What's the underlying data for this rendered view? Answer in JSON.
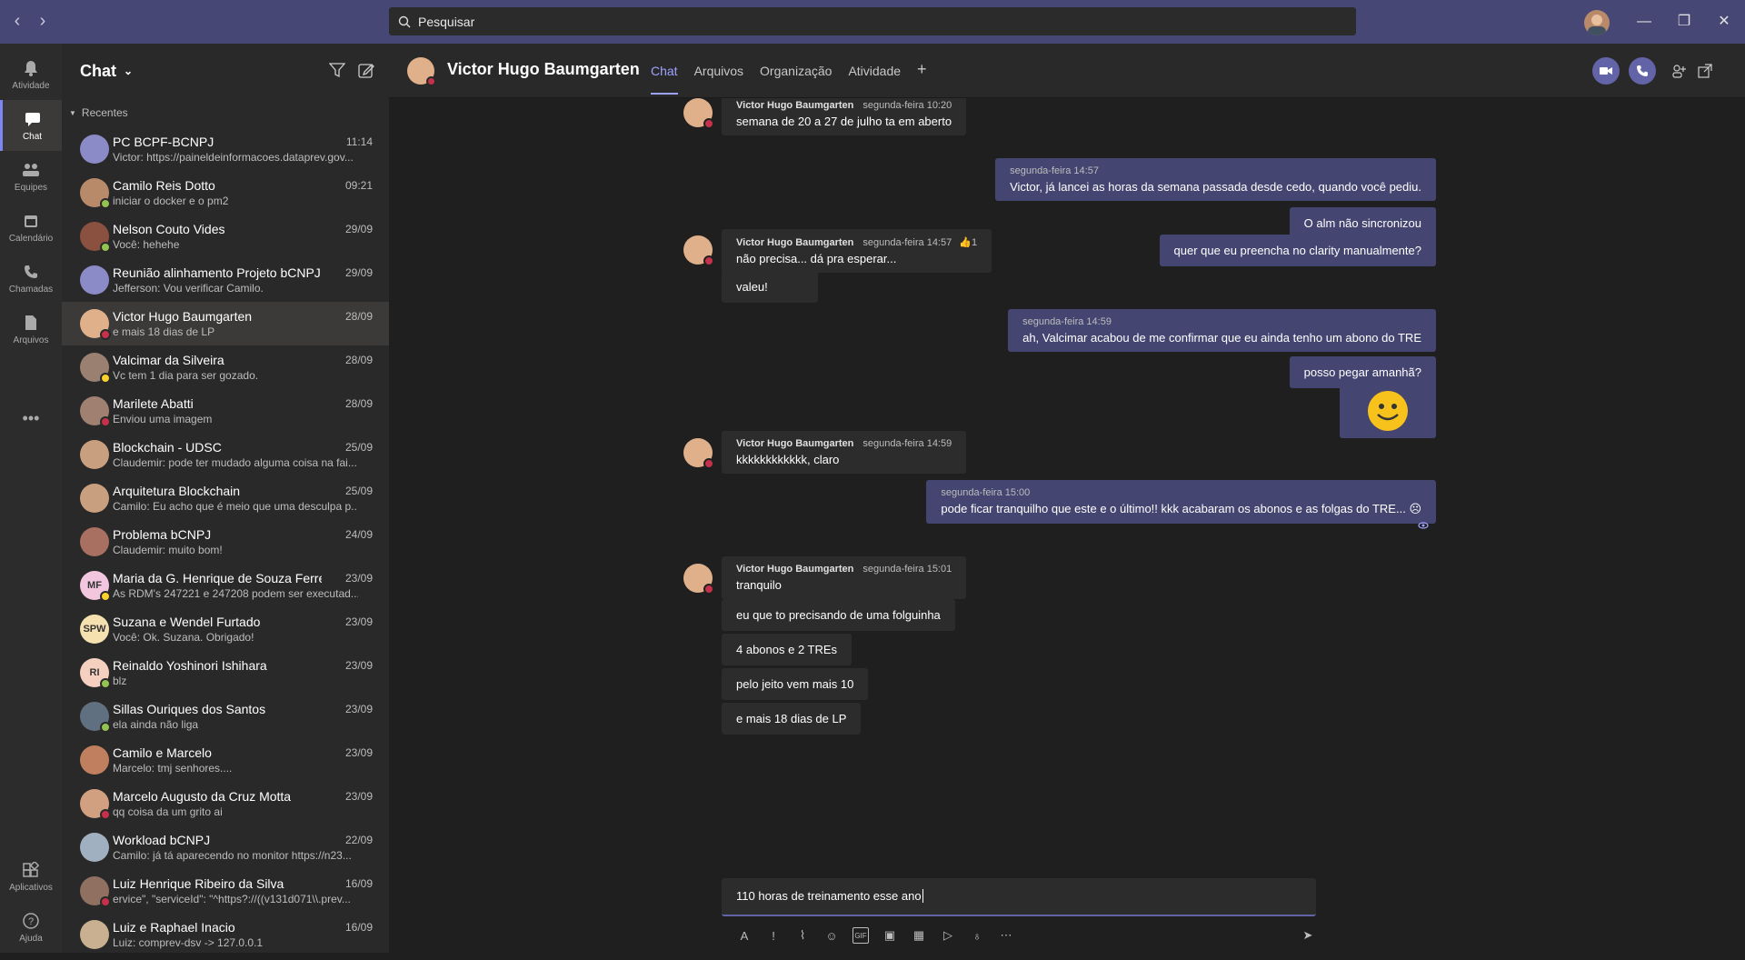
{
  "search": {
    "placeholder": "Pesquisar"
  },
  "rail": [
    {
      "label": "Atividade",
      "icon": "bell-icon"
    },
    {
      "label": "Chat",
      "icon": "chat-icon"
    },
    {
      "label": "Equipes",
      "icon": "teams-icon"
    },
    {
      "label": "Calendário",
      "icon": "calendar-icon"
    },
    {
      "label": "Chamadas",
      "icon": "phone-icon"
    },
    {
      "label": "Arquivos",
      "icon": "file-icon"
    },
    {
      "label": "Aplicativos",
      "icon": "apps-icon"
    },
    {
      "label": "Ajuda",
      "icon": "help-icon"
    }
  ],
  "list": {
    "title": "Chat",
    "section": "Recentes",
    "items": [
      {
        "name": "PC BCPF-BCNPJ",
        "preview": "Victor: https://paineldeinformacoes.dataprev.gov...",
        "time": "11:14",
        "avatar_color": "#8b8cc7"
      },
      {
        "name": "Camilo Reis Dotto",
        "preview": "iniciar o docker e o pm2",
        "time": "09:21",
        "avatar_color": "#b88a6a",
        "status": "#92c353"
      },
      {
        "name": "Nelson Couto Vides",
        "preview": "Você: hehehe",
        "time": "29/09",
        "avatar_color": "#8a5040",
        "status": "#92c353"
      },
      {
        "name": "Reunião alinhamento Projeto bCNPJ",
        "preview": "Jefferson: Vou verificar Camilo.",
        "time": "29/09",
        "avatar_color": "#8b8cc7"
      },
      {
        "name": "Victor Hugo Baumgarten",
        "preview": "e mais 18 dias de LP",
        "time": "28/09",
        "avatar_color": "#e0b08a",
        "status": "#c4314b"
      },
      {
        "name": "Valcimar da Silveira",
        "preview": "Vc tem 1 dia para ser gozado.",
        "time": "28/09",
        "avatar_color": "#9a8070",
        "status": "#f8d22a"
      },
      {
        "name": "Marilete Abatti",
        "preview": "Enviou uma imagem",
        "time": "28/09",
        "avatar_color": "#a08070",
        "status": "#c4314b"
      },
      {
        "name": "Blockchain - UDSC",
        "preview": "Claudemir: pode ter mudado alguma coisa na fai...",
        "time": "25/09",
        "avatar_color": "#c8a080"
      },
      {
        "name": "Arquitetura Blockchain",
        "preview": "Camilo: Eu acho que é meio que uma desculpa p...",
        "time": "25/09",
        "avatar_color": "#c8a080"
      },
      {
        "name": "Problema bCNPJ",
        "preview": "Claudemir: muito bom!",
        "time": "24/09",
        "avatar_color": "#a87060"
      },
      {
        "name": "Maria da G. Henrique de Souza Ferreira",
        "preview": "As RDM's 247221 e 247208 podem ser executad...",
        "time": "23/09",
        "avatar_color": "#f3c6e0",
        "initials": "MF",
        "status": "#f8d22a"
      },
      {
        "name": "Suzana e Wendel Furtado",
        "preview": "Você: Ok. Suzana. Obrigado!",
        "time": "23/09",
        "avatar_color": "#f5e0b0",
        "initials": "SPW"
      },
      {
        "name": "Reinaldo Yoshinori Ishihara",
        "preview": "blz",
        "time": "23/09",
        "avatar_color": "#f5d0c0",
        "initials": "RI",
        "status": "#92c353"
      },
      {
        "name": "Sillas Ouriques dos Santos",
        "preview": "ela ainda não liga",
        "time": "23/09",
        "avatar_color": "#607080",
        "status": "#92c353"
      },
      {
        "name": "Camilo e Marcelo",
        "preview": "Marcelo: tmj senhores....",
        "time": "23/09",
        "avatar_color": "#c08060"
      },
      {
        "name": "Marcelo Augusto da Cruz Motta",
        "preview": "qq coisa da um grito ai",
        "time": "23/09",
        "avatar_color": "#d0a080",
        "status": "#c4314b"
      },
      {
        "name": "Workload bCNPJ",
        "preview": "Camilo: já tá aparecendo no monitor https://n23...",
        "time": "22/09",
        "avatar_color": "#a0b0c0"
      },
      {
        "name": "Luiz Henrique Ribeiro da Silva",
        "preview": "ervice\", \"serviceId\": \"^https?://((v131d071\\\\.prev...",
        "time": "16/09",
        "avatar_color": "#907060",
        "status": "#c4314b"
      },
      {
        "name": "Luiz e Raphael Inacio",
        "preview": "Luiz: comprev-dsv -> 127.0.0.1",
        "time": "16/09",
        "avatar_color": "#c8b090"
      }
    ]
  },
  "header": {
    "name": "Victor Hugo Baumgarten",
    "tabs": [
      "Chat",
      "Arquivos",
      "Organização",
      "Atividade"
    ]
  },
  "messages": {
    "m1_meta_name": "Victor Hugo Baumgarten",
    "m1_meta_time": "segunda-feira 10:20",
    "m1_text": "semana de 20 a 27 de julho ta em aberto",
    "m2_time": "segunda-feira 14:57",
    "m2_text": "Victor, já lancei as horas da semana passada desde cedo, quando você pediu.",
    "m3_text": "O alm não sincronizou",
    "m4_text": "quer que eu preencha no clarity manualmente?",
    "m5_name": "Victor Hugo Baumgarten",
    "m5_time": "segunda-feira 14:57",
    "m5_reaction": "1",
    "m5_text": "não precisa... dá pra esperar...",
    "m6_text": "valeu!",
    "m7_time": "segunda-feira 14:59",
    "m7_text": "ah, Valcimar acabou de me confirmar que eu ainda tenho um abono do TRE",
    "m8_text": "posso pegar amanhã?",
    "m9_name": "Victor Hugo Baumgarten",
    "m9_time": "segunda-feira 14:59",
    "m9_text": "kkkkkkkkkkkk, claro",
    "m10_time": "segunda-feira 15:00",
    "m10_text": "pode ficar tranquilho que este e o último!! kkk acabaram os abonos e as folgas do TRE...",
    "m11_name": "Victor Hugo Baumgarten",
    "m11_time": "segunda-feira 15:01",
    "m11_text": "tranquilo",
    "m12_text": "eu que to precisando de uma folguinha",
    "m13_text": "4 abonos e 2 TREs",
    "m14_text": "pelo jeito vem mais 10",
    "m15_text": "e mais 18 dias de LP"
  },
  "compose": {
    "text": "110 horas de treinamento esse ano"
  }
}
